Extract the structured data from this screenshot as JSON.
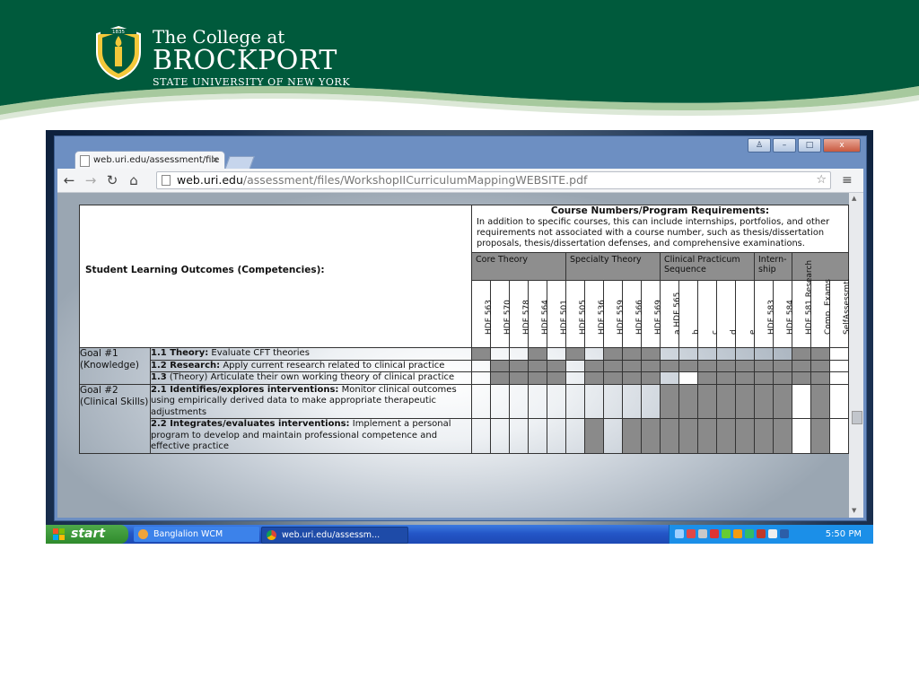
{
  "logo": {
    "seal_year": "1835",
    "line1": "The College at",
    "line2": "BROCKPORT",
    "line3": "STATE UNIVERSITY OF NEW YORK"
  },
  "colors": {
    "banner_green": "#005a3c",
    "taskbar_blue": "#245ac8",
    "start_green": "#3a9a36",
    "table_dark_cell": "#8a8a8a"
  },
  "browser": {
    "tab_title": "web.uri.edu/assessment/file",
    "tab_close": "×",
    "url_host": "web.uri.edu",
    "url_path": "/assessment/files/WorkshopIICurriculumMappingWEBSITE.pdf",
    "window_buttons": [
      "♙",
      "–",
      "□",
      "x"
    ],
    "nav_icons": [
      "back-icon",
      "forward-icon",
      "reload-icon",
      "home-icon"
    ]
  },
  "table": {
    "slo_title": "Student Learning Outcomes (Competencies):",
    "cn_title": "Course Numbers/Program Requirements:",
    "cn_desc": "In addition to specific courses, this can include internships, portfolios, and other requirements not associated with a course number, such as thesis/dissertation proposals, thesis/dissertation defenses, and comprehensive examinations.",
    "groups": [
      "Core Theory",
      "Specialty Theory",
      "Clinical Practicum Sequence",
      "Intern-ship",
      ""
    ],
    "columns": [
      "HDF 563",
      "HDF 570",
      "HDF 578",
      "HDF 564",
      "HDF 501",
      "HDF 505",
      "HDF 536",
      "HDF 559",
      "HDF 566",
      "HDF 569",
      "a HDF 565",
      "b",
      "c",
      "d",
      "e",
      "HDF 583",
      "HDF 584",
      "HDF 581 Research",
      "Comp. Exams",
      "SelfAssessmt."
    ],
    "goal1": "Goal #1 (Knowledge)",
    "goal2": "Goal #2 (Clinical Skills)",
    "rows": [
      {
        "bold": "1.1 Theory:",
        "text": " Evaluate CFT theories"
      },
      {
        "bold": "1.2 Research:",
        "text": " Apply current research related to clinical practice"
      },
      {
        "bold": "1.3",
        "text": " (Theory) Articulate their own working theory of clinical practice"
      },
      {
        "bold": "2.1 Identifies/explores interventions:",
        "text": " Monitor clinical outcomes using empirically derived data to make appropriate therapeutic adjustments"
      },
      {
        "bold": "2.2 Integrates/evaluates interventions:",
        "text": " Implement a personal program to develop and maintain professional competence and effective practice"
      }
    ],
    "cells": [
      "dttdtdtdddtttttttddw",
      "tddddtdddddddddddddw",
      "tddddtddddtwdddddddw",
      "ttttttttttdddddddwdw",
      "ttttttdtdddddddddwdw"
    ]
  },
  "taskbar": {
    "start": "start",
    "task1": "Banglalion WCM",
    "task2": "web.uri.edu/assessm...",
    "clock": "5:50 PM"
  }
}
